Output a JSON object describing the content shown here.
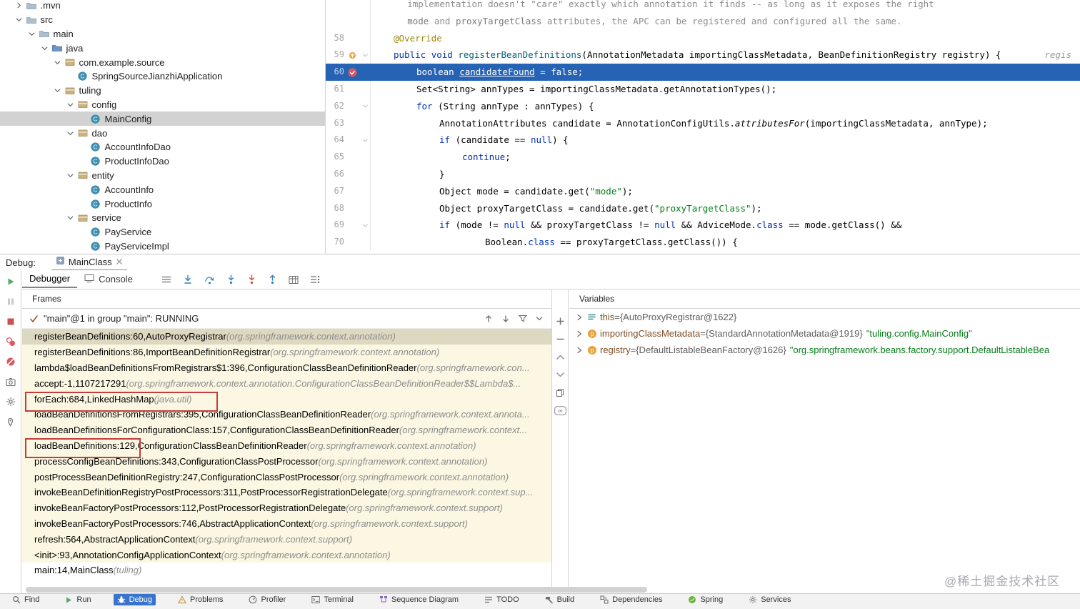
{
  "window": {
    "watermark": "@稀土掘金技术社区"
  },
  "colors": {
    "execution_line": "#2663B5",
    "breakpoint": "#DB5860",
    "frame_library_bg": "#FBF7E2",
    "selected_frame_bg": "#DDD8C0",
    "annotation_box": "#C43C3C",
    "active_tool_bg": "#3874CB",
    "string_green": "#067D17",
    "keyword_blue": "#0033B3"
  },
  "tree": {
    "items": [
      {
        "label": ".mvn",
        "level": 1,
        "kind": "folder",
        "arrow": "right"
      },
      {
        "label": "src",
        "level": 1,
        "kind": "folder",
        "arrow": "down"
      },
      {
        "label": "main",
        "level": 2,
        "kind": "folder",
        "arrow": "down"
      },
      {
        "label": "java",
        "level": 3,
        "kind": "srcfolder",
        "arrow": "down"
      },
      {
        "label": "com.example.source",
        "level": 4,
        "kind": "package",
        "arrow": "down"
      },
      {
        "label": "SpringSourceJianzhiApplication",
        "level": 5,
        "kind": "class"
      },
      {
        "label": "tuling",
        "level": 4,
        "kind": "package",
        "arrow": "down"
      },
      {
        "label": "config",
        "level": 5,
        "kind": "package",
        "arrow": "down"
      },
      {
        "label": "MainConfig",
        "level": 6,
        "kind": "class",
        "selected": true
      },
      {
        "label": "dao",
        "level": 5,
        "kind": "package",
        "arrow": "down"
      },
      {
        "label": "AccountInfoDao",
        "level": 6,
        "kind": "class"
      },
      {
        "label": "ProductInfoDao",
        "level": 6,
        "kind": "class"
      },
      {
        "label": "entity",
        "level": 5,
        "kind": "package",
        "arrow": "down"
      },
      {
        "label": "AccountInfo",
        "level": 6,
        "kind": "class"
      },
      {
        "label": "ProductInfo",
        "level": 6,
        "kind": "class"
      },
      {
        "label": "service",
        "level": 5,
        "kind": "package",
        "arrow": "down"
      },
      {
        "label": "PayService",
        "level": 6,
        "kind": "class"
      },
      {
        "label": "PayServiceImpl",
        "level": 6,
        "kind": "class"
      }
    ]
  },
  "editor": {
    "lines": [
      {
        "num": "",
        "ind": 1.6,
        "seg": [
          [
            "sc",
            "implementation doesn't \"care\" exactly which annotation it finds -- as long as it exposes the right"
          ]
        ]
      },
      {
        "num": "",
        "ind": 1.6,
        "seg": [
          [
            "scc",
            "mode"
          ],
          [
            "sc",
            " and "
          ],
          [
            "scc",
            "proxyTargetClass"
          ],
          [
            "sc",
            " attributes, the APC can be registered and configured all the same."
          ]
        ]
      },
      {
        "num": "58",
        "ind": 1,
        "seg": [
          [
            "sa",
            "@Override"
          ]
        ]
      },
      {
        "num": "59",
        "ind": 1,
        "gicon": "override-icon",
        "fold": true,
        "tail": "regis",
        "seg": [
          [
            "sk",
            "public "
          ],
          [
            "sk",
            "void "
          ],
          [
            "sm",
            "registerBeanDefinitions"
          ],
          [
            "sp",
            "(AnnotationMetadata importingClassMetadata, BeanDefinitionRegistry registry) {"
          ]
        ]
      },
      {
        "num": "60",
        "ind": 2,
        "exec": true,
        "gicon": "breakpoint-icon",
        "seg": [
          [
            "sp",
            "boolean "
          ],
          [
            "su",
            "candidateFound"
          ],
          [
            "sp",
            " = "
          ],
          [
            "sk",
            "false"
          ],
          [
            "sp",
            ";"
          ]
        ]
      },
      {
        "num": "61",
        "ind": 2,
        "seg": [
          [
            "sp",
            "Set<String> annTypes = importingClassMetadata.getAnnotationTypes();"
          ]
        ]
      },
      {
        "num": "62",
        "ind": 2,
        "fold": true,
        "seg": [
          [
            "sk",
            "for"
          ],
          [
            "sp",
            " (String annType : annTypes) {"
          ]
        ]
      },
      {
        "num": "63",
        "ind": 3,
        "seg": [
          [
            "sp",
            "AnnotationAttributes candidate = AnnotationConfigUtils."
          ],
          [
            "si",
            "attributesFor"
          ],
          [
            "sp",
            "(importingClassMetadata, annType);"
          ]
        ]
      },
      {
        "num": "64",
        "ind": 3,
        "fold": true,
        "seg": [
          [
            "sk",
            "if"
          ],
          [
            "sp",
            " (candidate == "
          ],
          [
            "sk",
            "null"
          ],
          [
            "sp",
            ") {"
          ]
        ]
      },
      {
        "num": "65",
        "ind": 4,
        "seg": [
          [
            "sk",
            "continue"
          ],
          [
            "sp",
            ";"
          ]
        ]
      },
      {
        "num": "66",
        "ind": 3,
        "seg": [
          [
            "sp",
            "}"
          ]
        ]
      },
      {
        "num": "67",
        "ind": 3,
        "seg": [
          [
            "sp",
            "Object mode = candidate.get("
          ],
          [
            "ss",
            "\"mode\""
          ],
          [
            "sp",
            ");"
          ]
        ]
      },
      {
        "num": "68",
        "ind": 3,
        "seg": [
          [
            "sp",
            "Object proxyTargetClass = candidate.get("
          ],
          [
            "ss",
            "\"proxyTargetClass\""
          ],
          [
            "sp",
            ");"
          ]
        ]
      },
      {
        "num": "69",
        "ind": 3,
        "fold": true,
        "seg": [
          [
            "sk",
            "if"
          ],
          [
            "sp",
            " (mode != "
          ],
          [
            "sk",
            "null"
          ],
          [
            "sp",
            " && proxyTargetClass != "
          ],
          [
            "sk",
            "null"
          ],
          [
            "sp",
            " && AdviceMode."
          ],
          [
            "sk",
            "class"
          ],
          [
            "sp",
            " == mode.getClass() &&"
          ]
        ]
      },
      {
        "num": "70",
        "ind": 5,
        "seg": [
          [
            "sp",
            "Boolean."
          ],
          [
            "sk",
            "class"
          ],
          [
            "sp",
            " == proxyTargetClass.getClass()) {"
          ]
        ]
      }
    ]
  },
  "debug_header": {
    "label": "Debug:",
    "tab": "MainClass"
  },
  "debug_toolbar": {
    "tabs": [
      "Debugger",
      "Console"
    ],
    "icons": [
      "hamburger-icon",
      "show-execution-point-icon",
      "step-over-icon",
      "step-into-icon",
      "force-step-into-icon",
      "step-out-icon",
      "view-as-table-icon",
      "settings-list-icon"
    ]
  },
  "rail": {
    "icons": [
      "resume-icon",
      "pause-icon",
      "stop-icon",
      "view-breakpoints-icon",
      "mute-breakpoints-icon",
      "thread-dump-icon",
      "settings-gear-icon",
      "pin-icon"
    ]
  },
  "frames": {
    "title": "Frames",
    "thread": "\"main\"@1 in group \"main\": RUNNING",
    "header_icons": [
      "arrow-up-icon",
      "arrow-down-icon",
      "filter-icon",
      "chevron-down-icon"
    ],
    "rows": [
      {
        "m": "registerBeanDefinitions:60,",
        "c": " AutoProxyRegistrar ",
        "p": "(org.springframework.context.annotation)",
        "sel": true
      },
      {
        "m": "registerBeanDefinitions:86,",
        "c": " ImportBeanDefinitionRegistrar ",
        "p": "(org.springframework.context.annotation)"
      },
      {
        "m": "lambda$loadBeanDefinitionsFromRegistrars$1:396,",
        "c": " ConfigurationClassBeanDefinitionReader ",
        "p": "(org.springframework.con..."
      },
      {
        "m": "accept:-1,",
        "c": " 1107217291 ",
        "p": "(org.springframework.context.annotation.ConfigurationClassBeanDefinitionReader$$Lambda$..."
      },
      {
        "m": "forEach:684,",
        "c": " LinkedHashMap ",
        "p": "(java.util)"
      },
      {
        "m": "loadBeanDefinitionsFromRegistrars:395,",
        "c": " ConfigurationClassBeanDefinitionReader ",
        "p": "(org.springframework.context.annota..."
      },
      {
        "m": "loadBeanDefinitionsForConfigurationClass:157,",
        "c": " ConfigurationClassBeanDefinitionReader ",
        "p": "(org.springframework.context..."
      },
      {
        "m": "loadBeanDefinitions:129,",
        "c": " ConfigurationClassBeanDefinitionReader ",
        "p": "(org.springframework.context.annotation)"
      },
      {
        "m": "processConfigBeanDefinitions:343,",
        "c": " ConfigurationClassPostProcessor ",
        "p": "(org.springframework.context.annotation)"
      },
      {
        "m": "postProcessBeanDefinitionRegistry:247,",
        "c": " ConfigurationClassPostProcessor ",
        "p": "(org.springframework.context.annotation)"
      },
      {
        "m": "invokeBeanDefinitionRegistryPostProcessors:311,",
        "c": " PostProcessorRegistrationDelegate ",
        "p": "(org.springframework.context.sup..."
      },
      {
        "m": "invokeBeanFactoryPostProcessors:112,",
        "c": " PostProcessorRegistrationDelegate ",
        "p": "(org.springframework.context.support)"
      },
      {
        "m": "invokeBeanFactoryPostProcessors:746,",
        "c": " AbstractApplicationContext ",
        "p": "(org.springframework.context.support)"
      },
      {
        "m": "refresh:564,",
        "c": " AbstractApplicationContext ",
        "p": "(org.springframework.context.support)"
      },
      {
        "m": "<init>:93,",
        "c": " AnnotationConfigApplicationContext ",
        "p": "(org.springframework.context.annotation)"
      },
      {
        "m": "main:14,",
        "c": " MainClass ",
        "p": "(tuling)",
        "user": true
      }
    ]
  },
  "watch_strip": {
    "icons": [
      "add-watch-icon",
      "remove-watch-icon",
      "scroll-up-icon",
      "scroll-down-icon",
      "copy-icon",
      "evaluate-icon"
    ]
  },
  "variables": {
    "title": "Variables",
    "rows": [
      {
        "icon": "this-value-icon",
        "name": "this",
        "value": "{AutoProxyRegistrar@1622}"
      },
      {
        "icon": "parameter-icon",
        "name": "importingClassMetadata",
        "value": "{StandardAnnotationMetadata@1919}",
        "str": "\"tuling.config.MainConfig\""
      },
      {
        "icon": "parameter-icon",
        "name": "registry",
        "value": "{DefaultListableBeanFactory@1626}",
        "str": "\"org.springframework.beans.factory.support.DefaultListableBea"
      }
    ]
  },
  "statusbar": {
    "items": [
      {
        "icon": "search-icon",
        "label": "Find"
      },
      {
        "icon": "run-icon",
        "label": "Run"
      },
      {
        "icon": "debug-icon",
        "label": "Debug",
        "active": true
      },
      {
        "icon": "problems-icon",
        "label": "Problems"
      },
      {
        "icon": "profiler-icon",
        "label": "Profiler"
      },
      {
        "icon": "terminal-icon",
        "label": "Terminal"
      },
      {
        "icon": "sequence-icon",
        "label": "Sequence Diagram"
      },
      {
        "icon": "todo-icon",
        "label": "TODO"
      },
      {
        "icon": "build-icon",
        "label": "Build"
      },
      {
        "icon": "dependencies-icon",
        "label": "Dependencies"
      },
      {
        "icon": "spring-icon",
        "label": "Spring"
      },
      {
        "icon": "services-icon",
        "label": "Services"
      }
    ]
  }
}
